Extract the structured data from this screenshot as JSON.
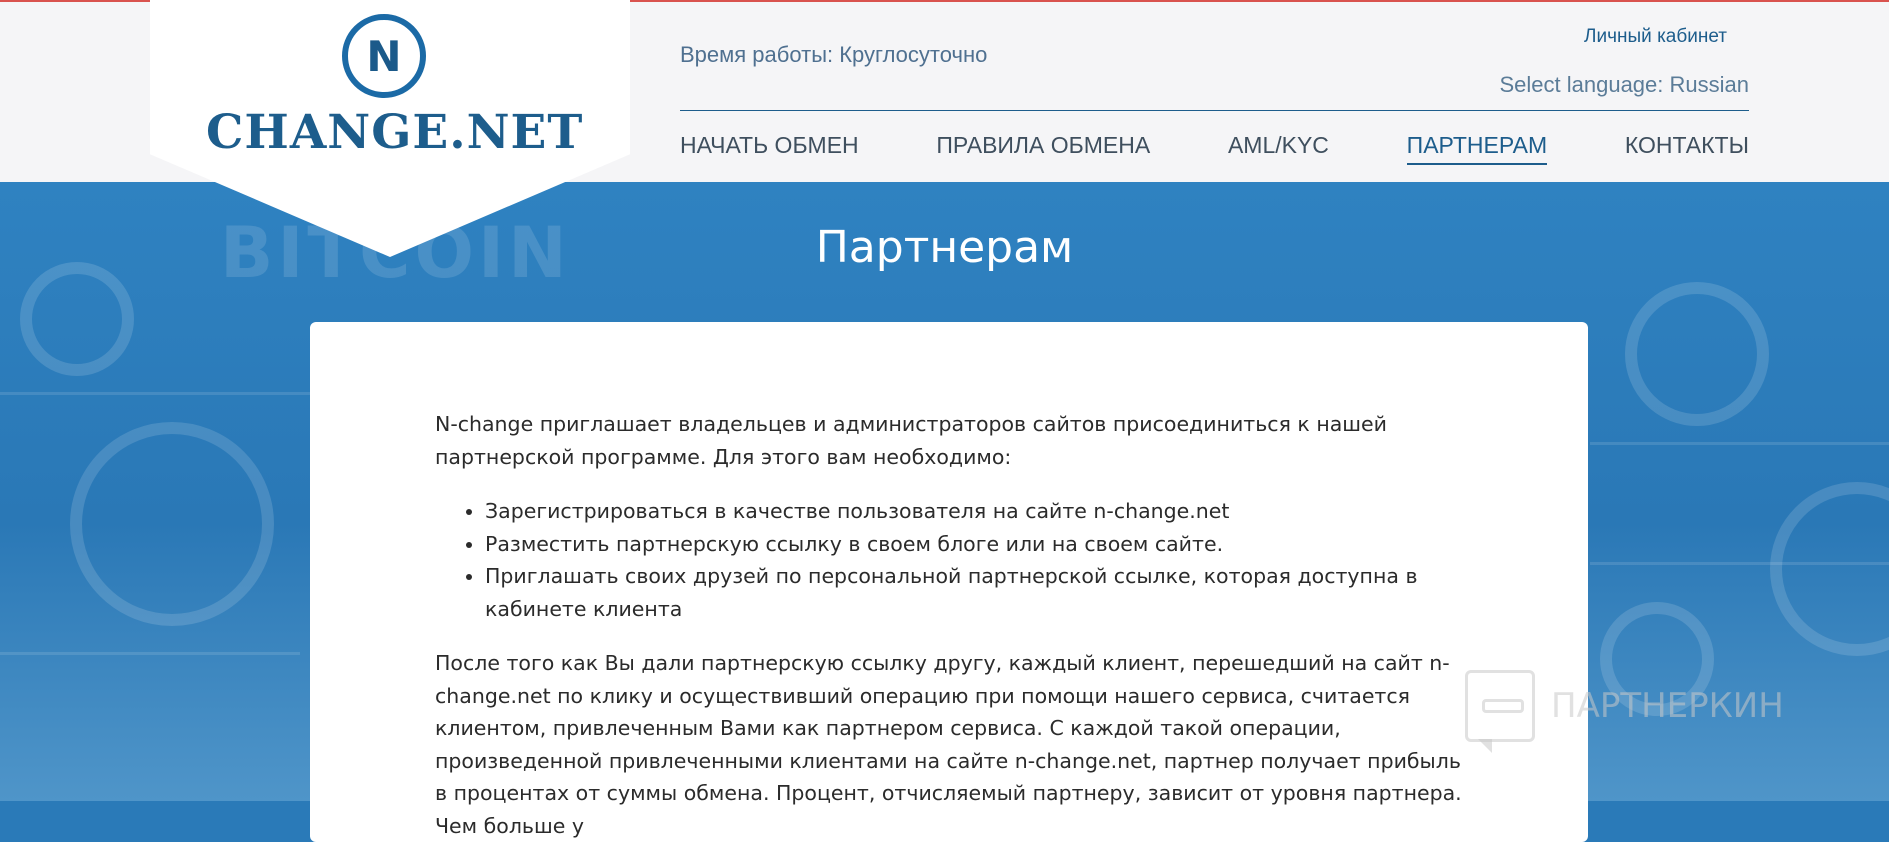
{
  "header": {
    "logo_letter": "N",
    "logo_text": "CHANGE.NET",
    "worktime": "Время работы: Круглосуточно",
    "cabinet": "Личный кабинет",
    "language_label": "Select language:",
    "language_value": "Russian"
  },
  "nav": {
    "items": [
      {
        "label": "НАЧАТЬ ОБМЕН"
      },
      {
        "label": "ПРАВИЛА ОБМЕНА"
      },
      {
        "label": "AML/KYC"
      },
      {
        "label": "ПАРТНЕРАМ"
      },
      {
        "label": "КОНТАКТЫ"
      }
    ]
  },
  "hero": {
    "bg_word": "BITCOIN",
    "title": "Партнерам"
  },
  "content": {
    "intro": "N-change приглашает владельцев и администраторов сайтов присоединиться к нашей партнерской программе. Для этого вам необходимо:",
    "list": [
      "Зарегистрироваться в качестве пользователя на сайте n-change.net",
      "Разместить партнерскую ссылку в своем блоге или на своем сайте.",
      "Приглашать своих друзей по персональной партнерской ссылке, которая доступна в кабинете клиента"
    ],
    "paragraph2": "После того как Вы дали партнерскую ссылку другу, каждый клиент, перешедший на сайт n-change.net по клику и осуществивший операцию при помощи нашего сервиса, считается клиентом, привлеченным Вами как партнером сервиса. С каждой такой операции, произведенной привлеченными клиентами на сайте n-change.net, партнер получает прибыль в процентах от суммы обмена. Процент, отчисляемый партнеру, зависит от уровня партнера. Чем больше у"
  },
  "watermark": {
    "text": "ПАРТНЕРКИН"
  },
  "colors": {
    "brand": "#1d5d8c",
    "hero_blue": "#2a78b6",
    "top_line": "#d9534f"
  }
}
